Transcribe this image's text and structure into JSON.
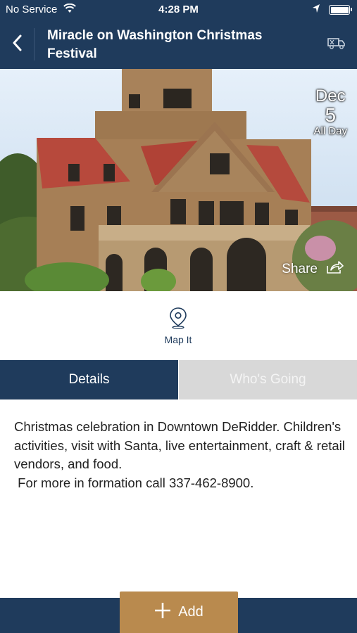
{
  "status_bar": {
    "carrier": "No Service",
    "time": "4:28 PM"
  },
  "nav": {
    "title": "Miracle on Washington Christmas Festival"
  },
  "event": {
    "month": "Dec",
    "day": "5",
    "time_label": "All Day",
    "share_label": "Share",
    "map_label": "Map It"
  },
  "tabs": [
    {
      "label": "Details",
      "active": true
    },
    {
      "label": "Who's Going",
      "active": false
    }
  ],
  "details": {
    "description": "Christmas celebration in Downtown DeRidder. Children's activities, visit with Santa, live entertainment, craft & retail vendors, and food.\n For more in formation call 337-462-8900."
  },
  "bottom": {
    "add_label": "Add"
  },
  "colors": {
    "navy": "#1f3b5c",
    "gold": "#b98a4e",
    "tab_inactive": "#d8d8d8"
  },
  "icons": {
    "back": "chevron-left-icon",
    "nav_action": "delivery-truck-icon",
    "share": "share-arrow-icon",
    "map": "location-pin-icon",
    "add": "plus-icon",
    "wifi": "wifi-icon",
    "location": "location-arrow-icon",
    "battery": "battery-icon"
  }
}
